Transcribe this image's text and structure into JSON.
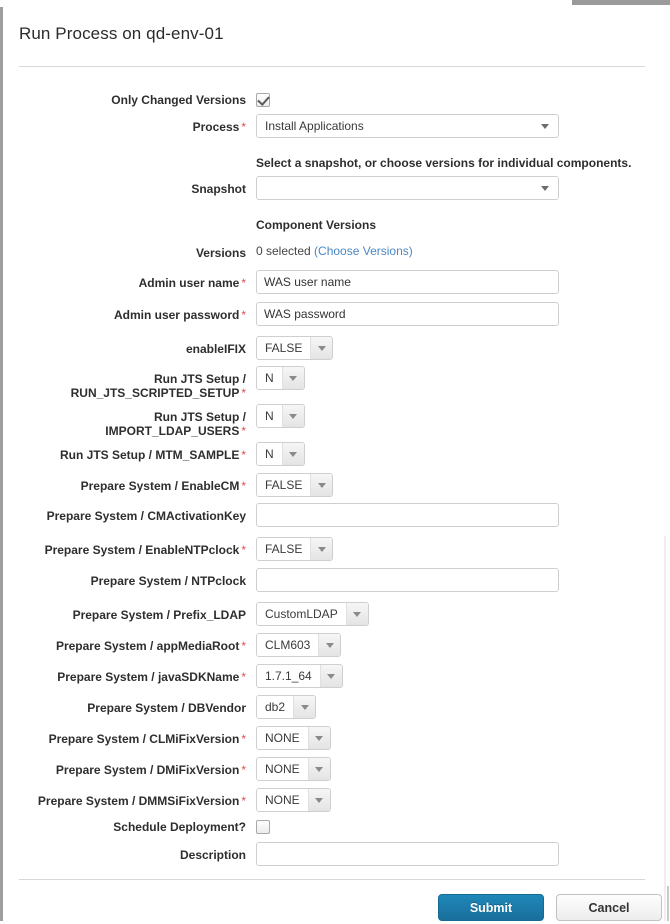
{
  "window": {
    "title": "Run Process on qd-env-01"
  },
  "form": {
    "note": "Select a snapshot, or choose versions for individual components.",
    "component_versions_heading": "Component Versions",
    "versions_value": "0 selected ",
    "versions_link": "(Choose Versions)",
    "rows": [
      {
        "label": "Only Changed Versions",
        "required": false,
        "type": "checkbox",
        "checked": true
      },
      {
        "label": "Process",
        "required": true,
        "type": "select-wide",
        "value": "Install Applications"
      },
      {
        "label": "",
        "required": false,
        "type": "note"
      },
      {
        "label": "Snapshot",
        "required": false,
        "type": "select-wide",
        "value": ""
      },
      {
        "label": "",
        "required": false,
        "type": "heading"
      },
      {
        "label": "Versions",
        "required": false,
        "type": "versions"
      },
      {
        "label": "Admin user name",
        "required": true,
        "type": "text",
        "value": "WAS user name"
      },
      {
        "label": "Admin user password",
        "required": true,
        "type": "text",
        "value": "WAS password"
      },
      {
        "label": "enableIFIX",
        "required": false,
        "type": "select",
        "value": "FALSE"
      },
      {
        "label": "Run JTS Setup / RUN_JTS_SCRIPTED_SETUP",
        "required": true,
        "type": "select",
        "value": "N"
      },
      {
        "label": "Run JTS Setup / IMPORT_LDAP_USERS",
        "required": true,
        "type": "select",
        "value": "N"
      },
      {
        "label": "Run JTS Setup / MTM_SAMPLE",
        "required": true,
        "type": "select",
        "value": "N"
      },
      {
        "label": "Prepare System / EnableCM",
        "required": true,
        "type": "select",
        "value": "FALSE"
      },
      {
        "label": "Prepare System / CMActivationKey",
        "required": false,
        "type": "text",
        "value": ""
      },
      {
        "label": "Prepare System / EnableNTPclock",
        "required": true,
        "type": "select",
        "value": "FALSE"
      },
      {
        "label": "Prepare System / NTPclock",
        "required": false,
        "type": "text",
        "value": ""
      },
      {
        "label": "Prepare System / Prefix_LDAP",
        "required": false,
        "type": "select",
        "value": "CustomLDAP"
      },
      {
        "label": "Prepare System / appMediaRoot",
        "required": true,
        "type": "select",
        "value": "CLM603"
      },
      {
        "label": "Prepare System / javaSDKName",
        "required": true,
        "type": "select",
        "value": "1.7.1_64"
      },
      {
        "label": "Prepare System / DBVendor",
        "required": false,
        "type": "select",
        "value": "db2"
      },
      {
        "label": "Prepare System / CLMiFixVersion",
        "required": true,
        "type": "select",
        "value": "NONE"
      },
      {
        "label": "Prepare System / DMiFixVersion",
        "required": true,
        "type": "select",
        "value": "NONE"
      },
      {
        "label": "Prepare System / DMMSiFixVersion",
        "required": true,
        "type": "select",
        "value": "NONE"
      },
      {
        "label": "Schedule Deployment?",
        "required": false,
        "type": "checkbox",
        "checked": false
      },
      {
        "label": "Description",
        "required": false,
        "type": "text",
        "value": ""
      }
    ]
  },
  "footer": {
    "submit_label": "Submit",
    "cancel_label": "Cancel"
  },
  "colors": {
    "submit_blue": "#1a6f9c",
    "link_blue": "#4a87c4",
    "required_red": "#d9534f"
  }
}
